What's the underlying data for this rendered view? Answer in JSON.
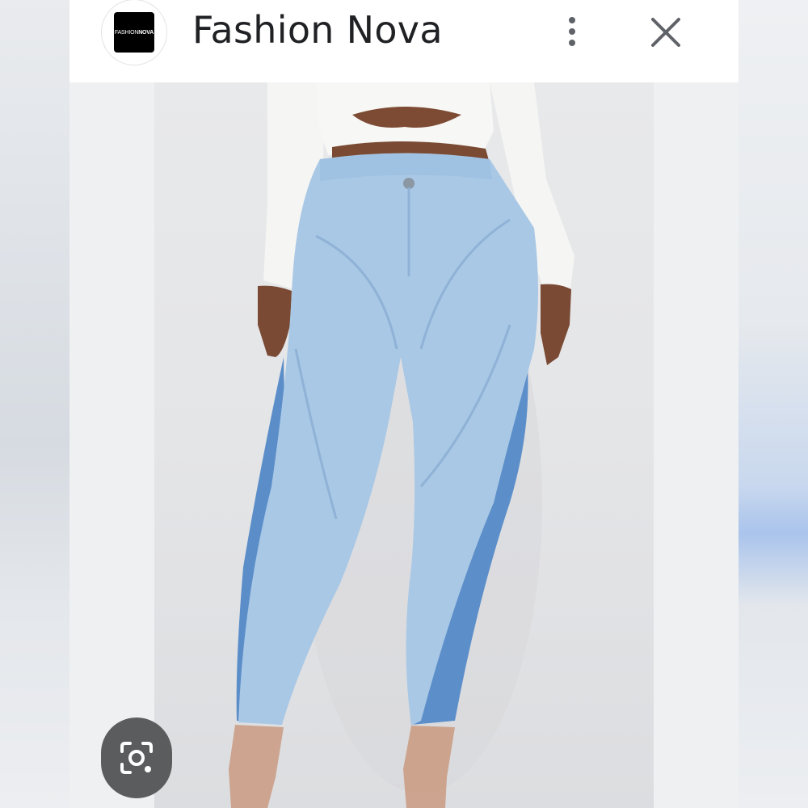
{
  "header": {
    "title": "Fashion Nova",
    "logo": {
      "text_light": "FASHION",
      "text_bold": "NOVA",
      "icon": "fashion-nova-logo"
    },
    "more_icon": "more-vertical-icon",
    "close_icon": "close-icon"
  },
  "product_image": {
    "description_icon": "product-photo",
    "colors": {
      "top": "#f4f4f2",
      "denim_light": "#a9c9e6",
      "denim_dark": "#5b8ec8",
      "skin": "#7a4a34",
      "background": "#e6e7e9"
    }
  },
  "lens_button": {
    "icon": "google-lens-icon"
  }
}
